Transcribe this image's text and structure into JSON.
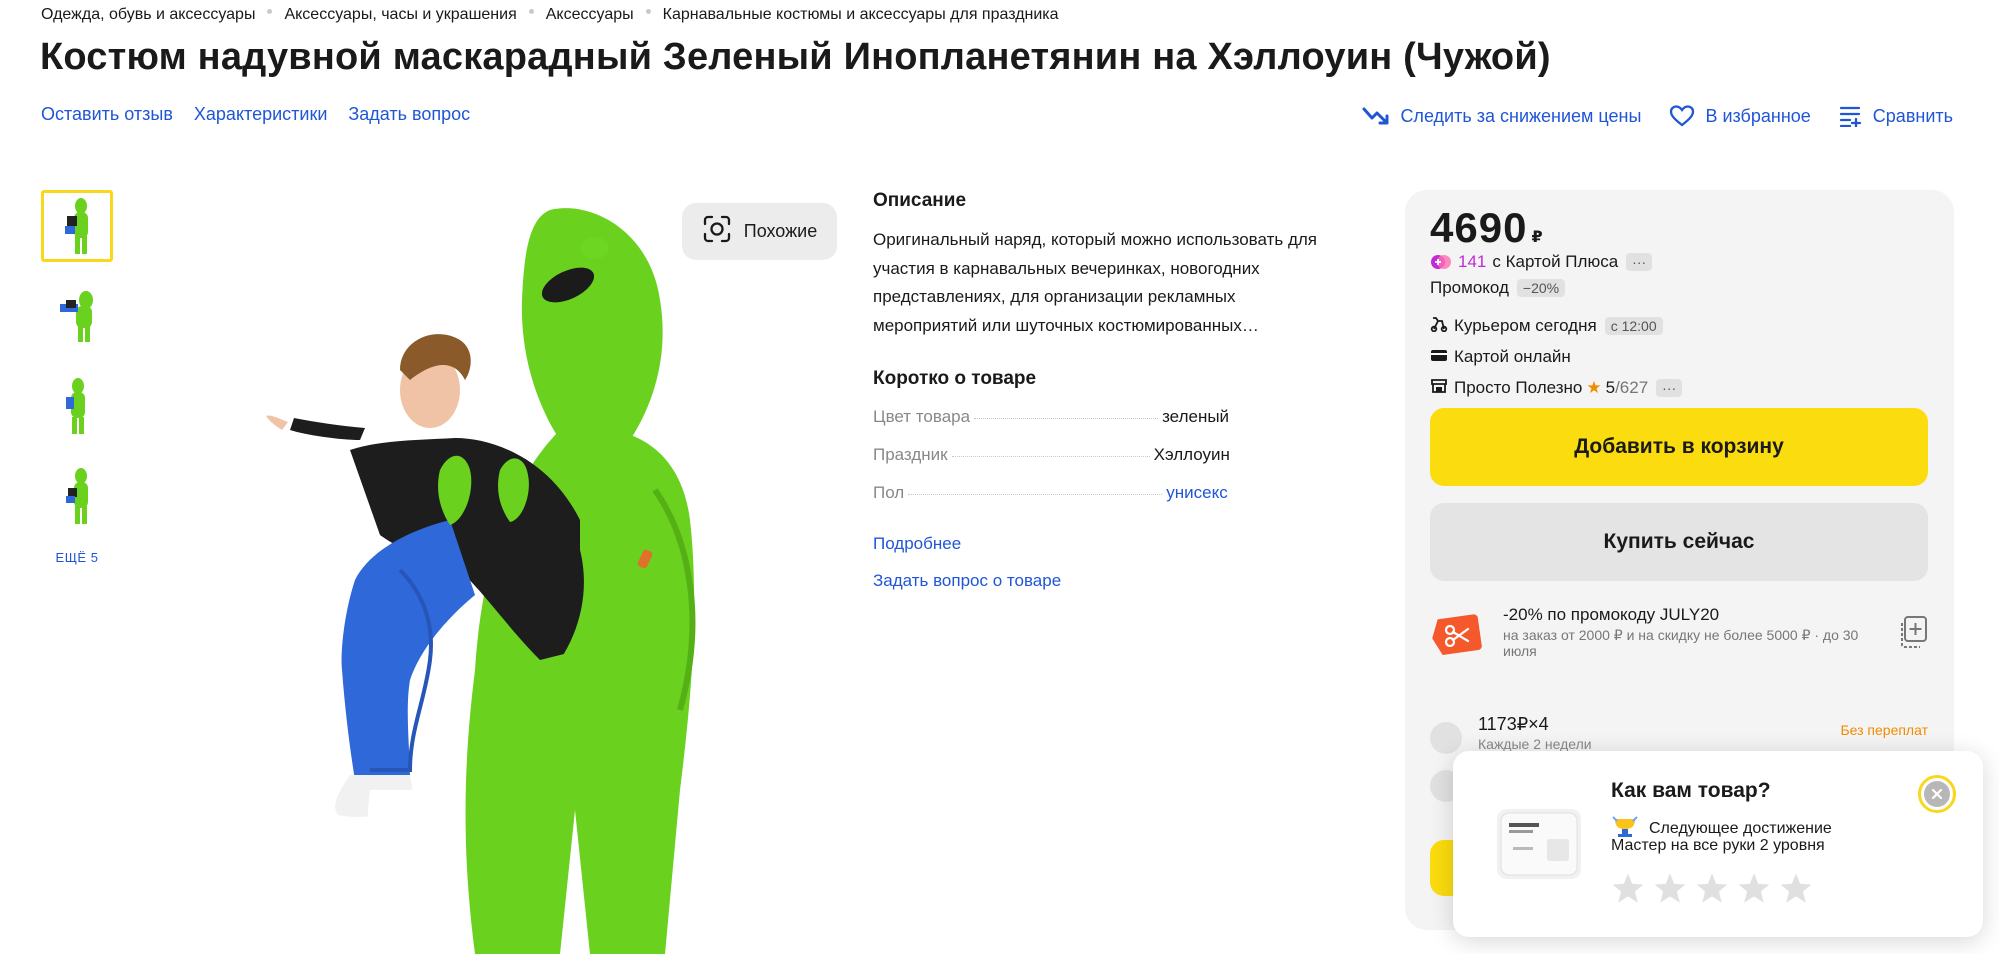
{
  "breadcrumbs": [
    "Одежда, обувь и аксессуары",
    "Аксессуары, часы и украшения",
    "Аксессуары",
    "Карнавальные костюмы и аксессуары для праздника"
  ],
  "title": "Костюм надувной маскарадный Зеленый Инопланетянин на Хэллоуин (Чужой)",
  "actions_left": {
    "review": "Оставить отзыв",
    "specs": "Характеристики",
    "question": "Задать вопрос"
  },
  "actions_right": {
    "price_watch": "Следить за снижением цены",
    "favorite": "В избранное",
    "compare": "Сравнить"
  },
  "gallery": {
    "more_label": "ЕЩЁ 5",
    "similar_label": "Похожие"
  },
  "description": {
    "title": "Описание",
    "text": "Оригинальный наряд, который можно использовать для участия в карнавальных вечеринках, новогодних представлениях, для организации рекламных мероприятий или шуточных костюмированных…",
    "short_title": "Коротко о товаре",
    "specs": [
      {
        "key": "Цвет товара",
        "value": "зеленый"
      },
      {
        "key": "Праздник",
        "value": "Хэллоуин"
      },
      {
        "key": "Пол",
        "value": "унисекс"
      }
    ],
    "more_link": "Подробнее",
    "ask_link": "Задать вопрос о товаре"
  },
  "card": {
    "price": "4690",
    "currency": "₽",
    "plus_points": "141",
    "plus_text": "с Картой Плюса",
    "more_dots": "···",
    "promo_label": "Промокод",
    "promo_discount": "−20%",
    "delivery": "Курьером сегодня",
    "delivery_time": "с 12:00",
    "payment": "Картой онлайн",
    "seller": "Просто Полезно",
    "seller_rating": "5",
    "seller_reviews": "/627",
    "cart_button": "Добавить в корзину",
    "buy_button": "Купить сейчас",
    "promo_code_title": "-20% по промокоду JULY20",
    "promo_code_sub": "на заказ от 2000 ₽ и на скидку не более 5000 ₽ · до 30 июля",
    "installment_main": "1173₽×4",
    "installment_sub": "Каждые 2 недели",
    "installment_tag": "Без переплат"
  },
  "popup": {
    "title": "Как вам товар?",
    "line1": "Следующее достижение",
    "line2": "Мастер на все руки 2 уровня",
    "stars": 5
  },
  "colors": {
    "accent_yellow": "#fbdc0e",
    "link_blue": "#1f55d6",
    "alien_green": "#6ad11f",
    "plus_pink": "#c22bd6",
    "orange": "#f28c00"
  }
}
